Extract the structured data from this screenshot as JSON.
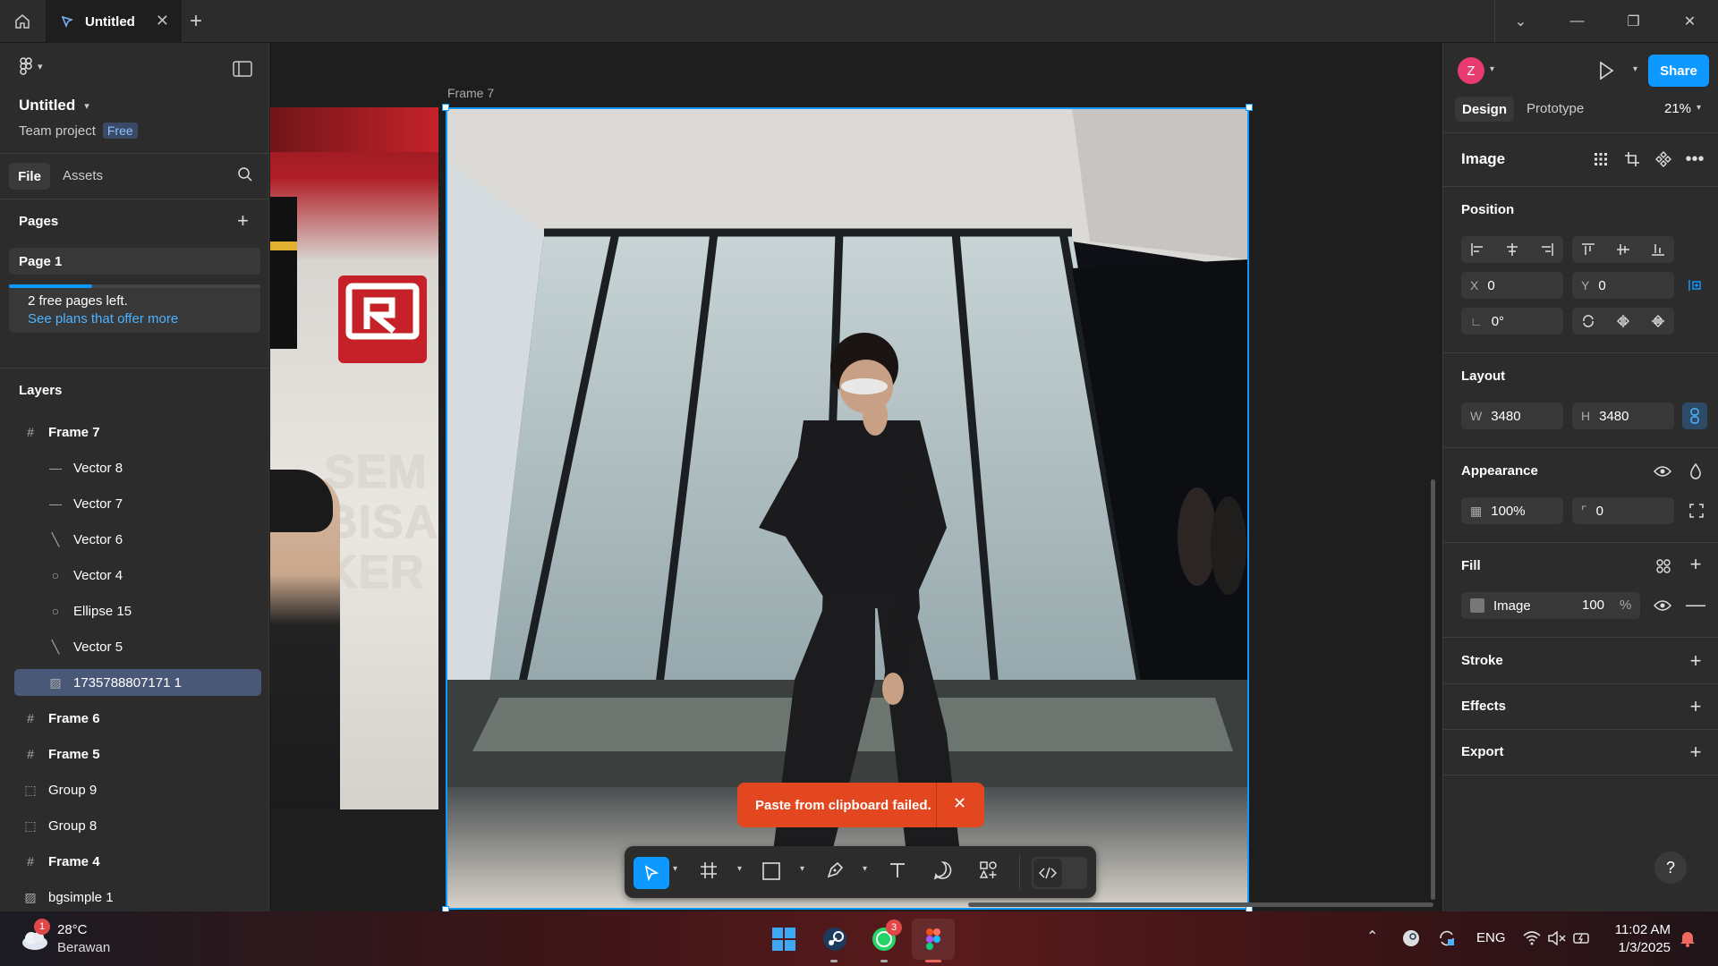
{
  "titlebar": {
    "tab_title": "Untitled",
    "window_controls": [
      "chevron-down-icon",
      "minimize-icon",
      "restore-icon",
      "close-icon"
    ]
  },
  "left": {
    "file_title": "Untitled",
    "project": "Team project",
    "plan_badge": "Free",
    "tab_file": "File",
    "tab_assets": "Assets",
    "pages_heading": "Pages",
    "page1": "Page 1",
    "free_pages": "2 free pages left.",
    "plans_link": "See plans that offer more",
    "free_pages_progress": 0.33,
    "layers_heading": "Layers",
    "layers": [
      {
        "name": "Frame 7",
        "icon": "frame-icon",
        "indent": 0,
        "bold": true
      },
      {
        "name": "Vector 8",
        "icon": "line-icon",
        "indent": 1,
        "bold": false
      },
      {
        "name": "Vector 7",
        "icon": "line-icon",
        "indent": 1,
        "bold": false
      },
      {
        "name": "Vector 6",
        "icon": "diagonal-line-icon",
        "indent": 1,
        "bold": false
      },
      {
        "name": "Vector 4",
        "icon": "ellipse-icon",
        "indent": 1,
        "bold": false
      },
      {
        "name": "Ellipse 15",
        "icon": "ellipse-icon",
        "indent": 1,
        "bold": false
      },
      {
        "name": "Vector 5",
        "icon": "diagonal-line-icon",
        "indent": 1,
        "bold": false
      },
      {
        "name": "1735788807171 1",
        "icon": "image-icon",
        "indent": 1,
        "bold": false,
        "selected": true
      },
      {
        "name": "Frame 6",
        "icon": "frame-icon",
        "indent": 0,
        "bold": true
      },
      {
        "name": "Frame 5",
        "icon": "frame-icon",
        "indent": 0,
        "bold": true
      },
      {
        "name": "Group 9",
        "icon": "group-icon",
        "indent": 0,
        "bold": false
      },
      {
        "name": "Group 8",
        "icon": "group-icon",
        "indent": 0,
        "bold": false
      },
      {
        "name": "Frame 4",
        "icon": "frame-icon",
        "indent": 0,
        "bold": true
      },
      {
        "name": "bgsimple 1",
        "icon": "image-icon",
        "indent": 0,
        "bold": false
      }
    ]
  },
  "canvas": {
    "frame_label": "Frame 7",
    "toast": "Paste from clipboard failed."
  },
  "right": {
    "avatar_letter": "Z",
    "share": "Share",
    "tab_design": "Design",
    "tab_prototype": "Prototype",
    "zoom": "21%",
    "selection_type": "Image",
    "position_heading": "Position",
    "x_label": "X",
    "x_value": "0",
    "y_label": "Y",
    "y_value": "0",
    "rotation": "0°",
    "layout_heading": "Layout",
    "w_label": "W",
    "w_value": "3480",
    "h_label": "H",
    "h_value": "3480",
    "appearance_heading": "Appearance",
    "opacity": "100%",
    "radius": "0",
    "fill_heading": "Fill",
    "fill_type": "Image",
    "fill_opacity": "100",
    "fill_unit": "%",
    "stroke_heading": "Stroke",
    "effects_heading": "Effects",
    "export_heading": "Export",
    "help": "?"
  },
  "taskbar": {
    "weather_temp": "28°C",
    "weather_desc": "Berawan",
    "weather_badge": "1",
    "whatsapp_badge": "3",
    "lang": "ENG",
    "time": "11:02 AM",
    "date": "1/3/2025"
  },
  "colors": {
    "accent": "#0d99ff",
    "toast": "#e2471f",
    "selected_layer": "#4a5878"
  }
}
